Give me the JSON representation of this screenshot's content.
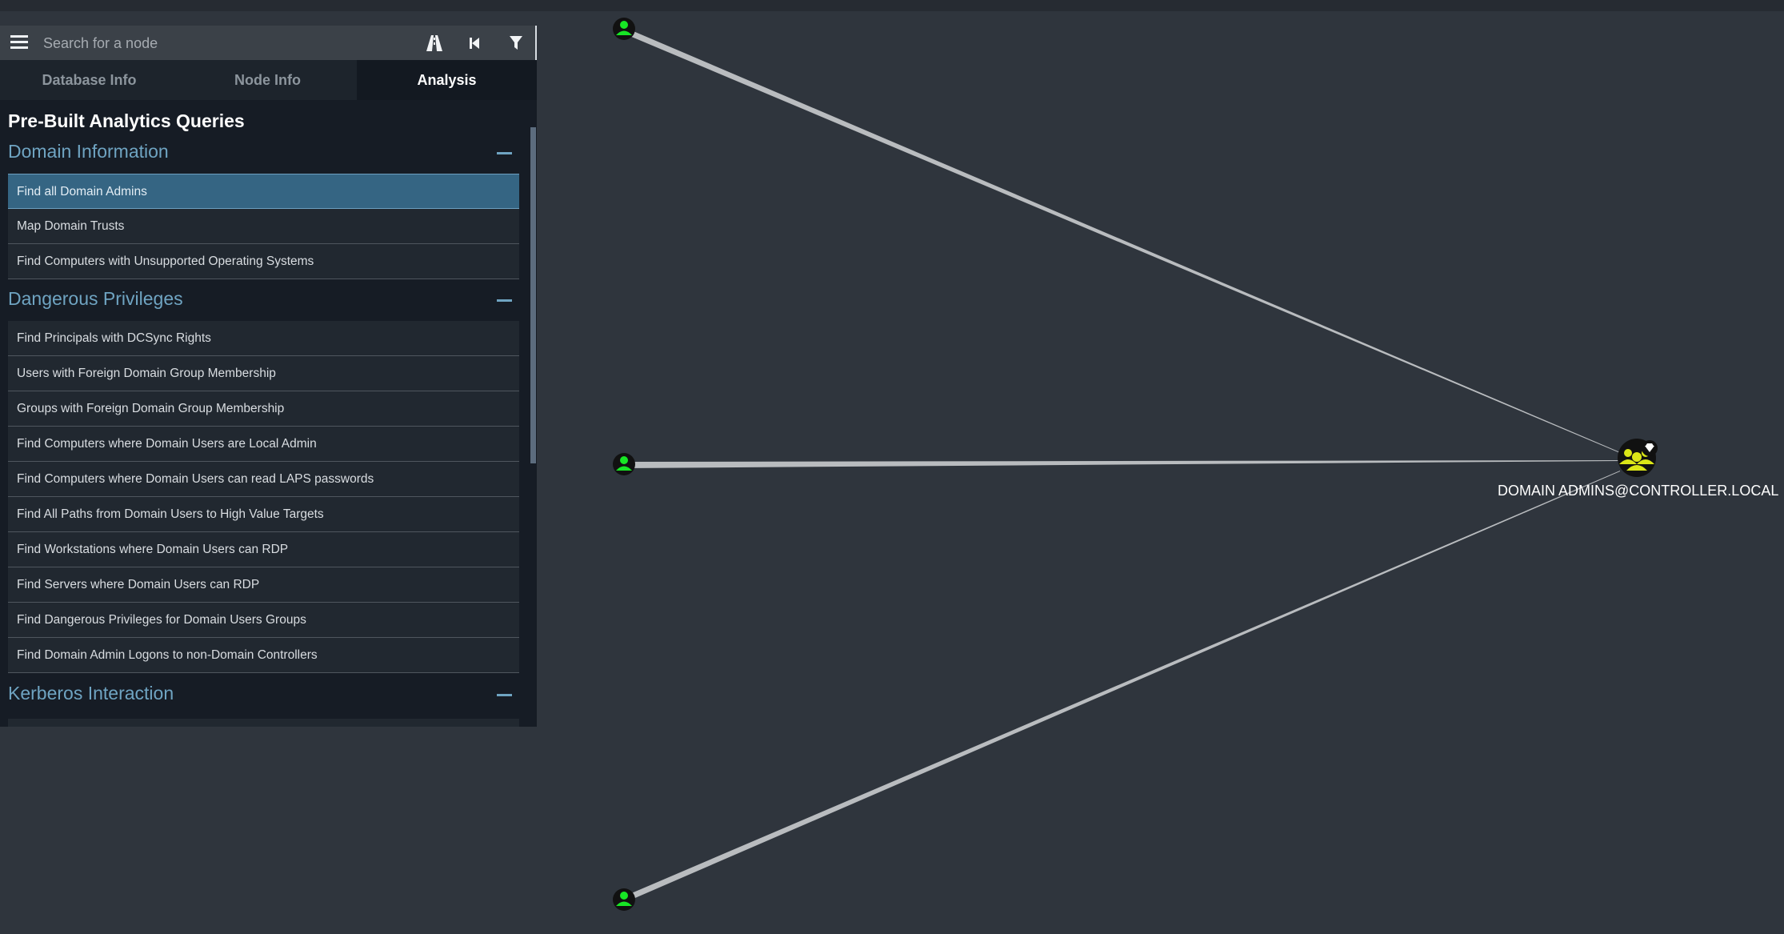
{
  "search": {
    "placeholder": "Search for a node"
  },
  "toolbar": {
    "menu_icon": "hamburger-menu-icon",
    "pathfinding_icon": "road-icon",
    "back_icon": "step-backward-icon",
    "filter_icon": "filter-icon"
  },
  "tabs": [
    {
      "label": "Database Info",
      "active": false
    },
    {
      "label": "Node Info",
      "active": false
    },
    {
      "label": "Analysis",
      "active": true
    }
  ],
  "analysis": {
    "title": "Pre-Built Analytics Queries",
    "sections": [
      {
        "title": "Domain Information",
        "items": [
          "Find all Domain Admins",
          "Map Domain Trusts",
          "Find Computers with Unsupported Operating Systems"
        ],
        "selected_index": 0
      },
      {
        "title": "Dangerous Privileges",
        "items": [
          "Find Principals with DCSync Rights",
          "Users with Foreign Domain Group Membership",
          "Groups with Foreign Domain Group Membership",
          "Find Computers where Domain Users are Local Admin",
          "Find Computers where Domain Users can read LAPS passwords",
          "Find All Paths from Domain Users to High Value Targets",
          "Find Workstations where Domain Users can RDP",
          "Find Servers where Domain Users can RDP",
          "Find Dangerous Privileges for Domain Users Groups",
          "Find Domain Admin Logons to non-Domain Controllers"
        ]
      },
      {
        "title": "Kerberos Interaction",
        "items": []
      }
    ]
  },
  "graph": {
    "target_node": {
      "label": "DOMAIN ADMINS@CONTROLLER.LOCAL",
      "type": "group",
      "high_value": true,
      "icon": "group-icon"
    },
    "user_nodes": [
      {
        "type": "user",
        "icon": "user-icon"
      },
      {
        "type": "user",
        "icon": "user-icon"
      },
      {
        "type": "user",
        "icon": "user-icon"
      }
    ],
    "colors": {
      "background": "#2f353d",
      "user_node": "#17e625",
      "group_node": "#dbe617",
      "edge": "#b9bcbf"
    }
  }
}
